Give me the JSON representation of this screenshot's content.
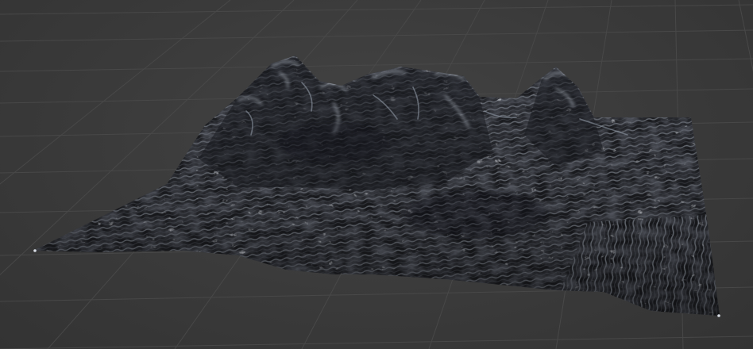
{
  "viewport": {
    "background_color": "#3a3a3a",
    "grid_color": "#4a4a4a",
    "terrain_base_color": "#1e1f24",
    "terrain_highlight_color": "#b9c2cf",
    "content": "terrain-mesh"
  }
}
